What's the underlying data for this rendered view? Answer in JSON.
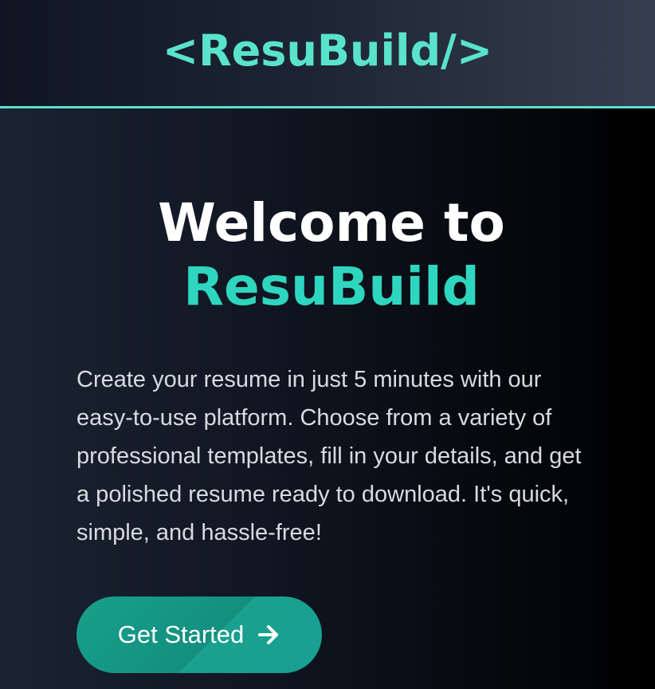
{
  "header": {
    "logo": "<ResuBuild/>"
  },
  "hero": {
    "title_line1": "Welcome to",
    "title_line2": "ResuBuild",
    "description": "Create your resume in just 5 minutes with our easy-to-use platform. Choose from a variety of professional templates, fill in your details, and get a polished resume ready to download. It's quick, simple, and hassle-free!",
    "cta_label": "Get Started",
    "cta_icon": "arrow-right-icon"
  },
  "colors": {
    "accent": "#2fd6bf",
    "header_border": "#5fe0cf",
    "button": "#159a88"
  }
}
